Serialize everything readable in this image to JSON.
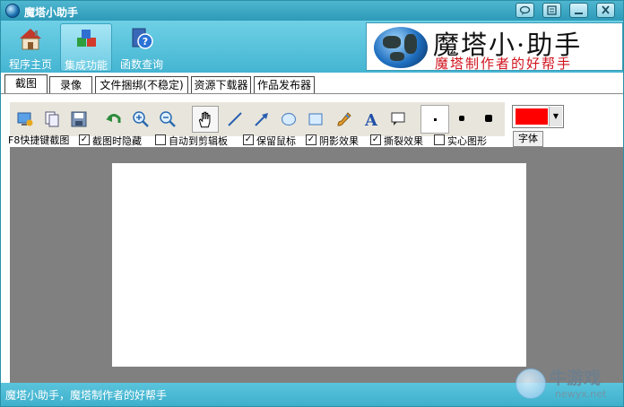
{
  "window": {
    "title": "魔塔小助手",
    "buttons": [
      "feedback",
      "menu",
      "minimize",
      "close"
    ]
  },
  "nav": [
    {
      "label": "程序主页",
      "icon": "home-icon"
    },
    {
      "label": "集成功能",
      "icon": "blocks-icon",
      "active": true
    },
    {
      "label": "函数查询",
      "icon": "help-book-icon"
    }
  ],
  "banner": {
    "title": "魔塔小·助手",
    "subtitle": "魔塔制作者的好帮手"
  },
  "tabs": [
    {
      "label": "截图",
      "active": true
    },
    {
      "label": "录像"
    },
    {
      "label": "文件捆绑(不稳定)"
    },
    {
      "label": "资源下载器"
    },
    {
      "label": "作品发布器"
    }
  ],
  "tools": [
    "capture-screen-icon",
    "copy-icon",
    "save-icon",
    "undo-icon",
    "zoom-in-icon",
    "zoom-out-icon",
    "hand-icon",
    "line-icon",
    "arrow-icon",
    "ellipse-icon",
    "rectangle-icon",
    "brush-icon",
    "text-icon",
    "callout-icon"
  ],
  "color": {
    "selected": "#ff0000"
  },
  "options": {
    "hotkey_label": "F8快捷键截图",
    "items": [
      {
        "label": "截图时隐藏",
        "checked": true
      },
      {
        "label": "自动到剪辑板",
        "checked": false
      },
      {
        "label": "保留鼠标",
        "checked": true
      },
      {
        "label": "阴影效果",
        "checked": true
      },
      {
        "label": "撕裂效果",
        "checked": true
      },
      {
        "label": "实心图形",
        "checked": false
      }
    ],
    "font_button": "字体"
  },
  "status": {
    "text": "魔塔小助手，魔塔制作者的好帮手"
  },
  "watermark": {
    "title": "牛游戏",
    "url": "newyx.net"
  }
}
